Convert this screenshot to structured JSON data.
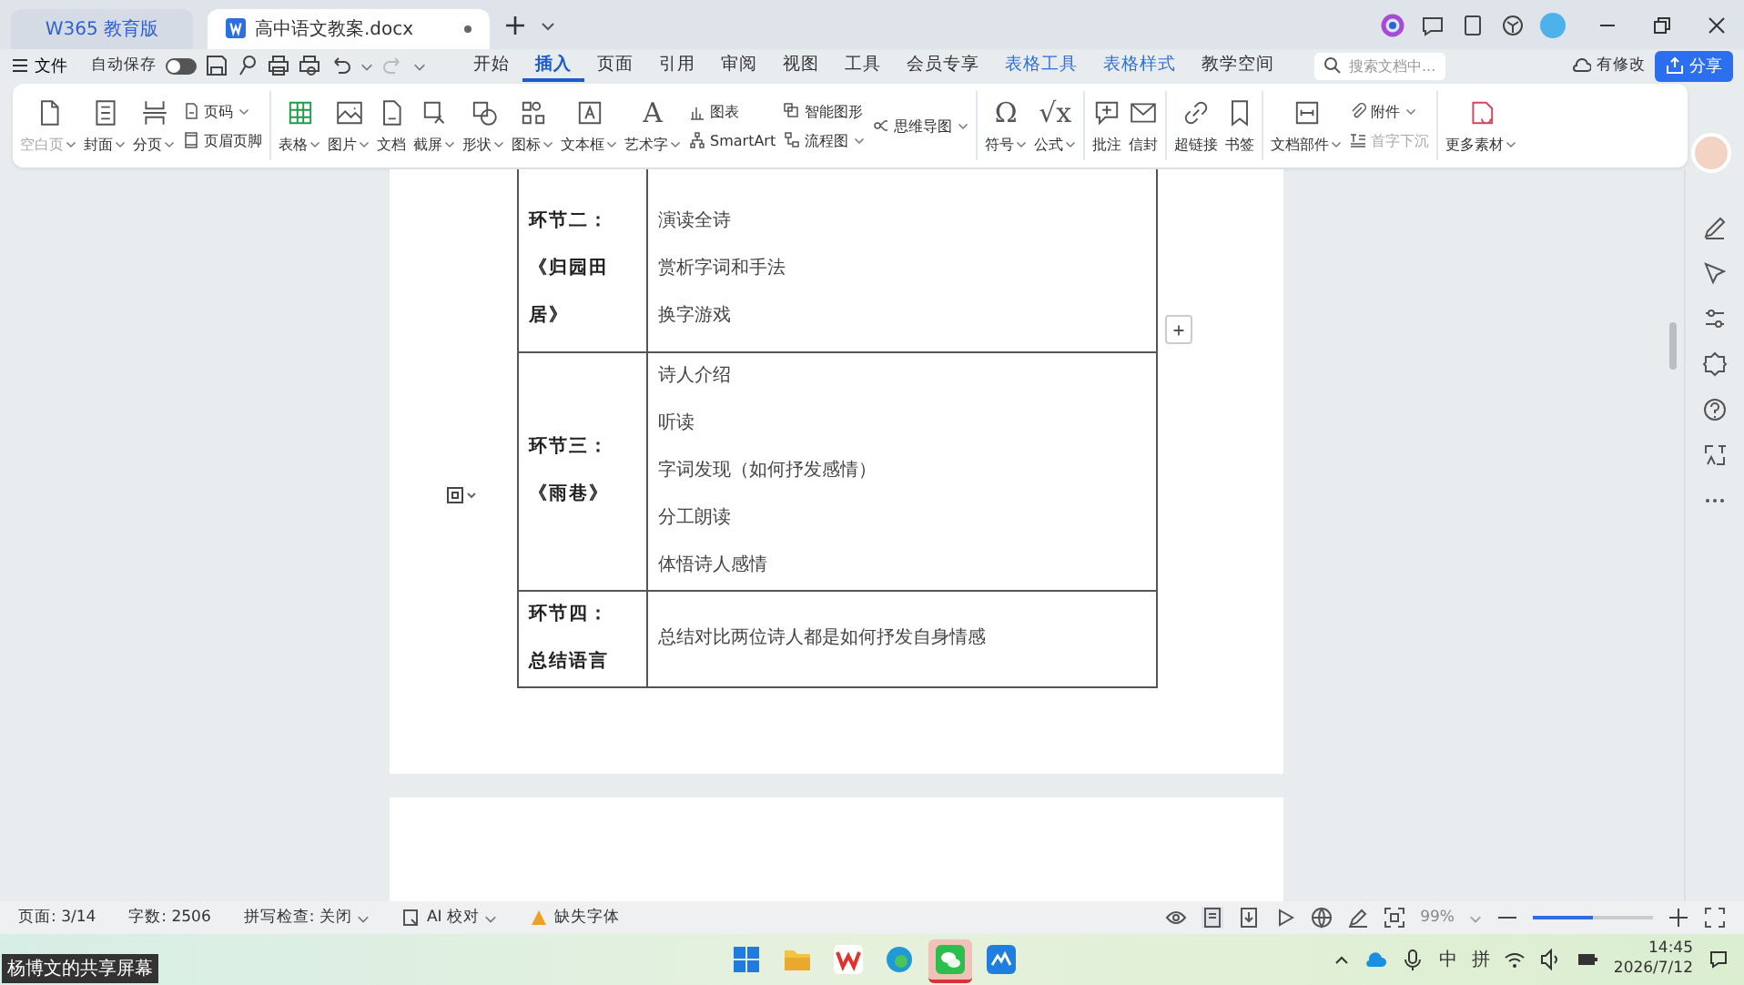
{
  "title_bar": {
    "tabs": [
      {
        "kind": "home",
        "label": "W365 教育版",
        "selected": false
      },
      {
        "kind": "doc",
        "label": "高中语文教案.docx",
        "selected": true
      }
    ]
  },
  "menu_bar": {
    "file": "文件",
    "autosave": {
      "label": "自动保存",
      "on": false
    },
    "tabs": [
      {
        "label": "开始",
        "selected": false,
        "contextual": false
      },
      {
        "label": "插入",
        "selected": true,
        "contextual": false
      },
      {
        "label": "页面",
        "selected": false,
        "contextual": false
      },
      {
        "label": "引用",
        "selected": false,
        "contextual": false
      },
      {
        "label": "审阅",
        "selected": false,
        "contextual": false
      },
      {
        "label": "视图",
        "selected": false,
        "contextual": false
      },
      {
        "label": "工具",
        "selected": false,
        "contextual": false
      },
      {
        "label": "会员专享",
        "selected": false,
        "contextual": false
      },
      {
        "label": "表格工具",
        "selected": false,
        "contextual": true
      },
      {
        "label": "表格样式",
        "selected": false,
        "contextual": true
      },
      {
        "label": "教学空间",
        "selected": false,
        "contextual": false
      }
    ],
    "search": {
      "placeholder": "搜索文档中..."
    },
    "status": "有修改",
    "share": "分享"
  },
  "ribbon": {
    "groups": [
      {
        "columns": [
          {
            "kind": "large",
            "label": "空白页",
            "dropdown": true,
            "disabled": true
          },
          {
            "kind": "large",
            "label": "封面",
            "dropdown": true,
            "disabled": false
          },
          {
            "kind": "large",
            "label": "分页",
            "dropdown": true,
            "disabled": false
          },
          {
            "kind": "stack",
            "items": [
              {
                "label": "页码",
                "dropdown": true,
                "disabled": false
              },
              {
                "label": "页眉页脚",
                "dropdown": false,
                "disabled": false
              }
            ]
          }
        ]
      },
      {
        "columns": [
          {
            "kind": "large",
            "label": "表格",
            "dropdown": true,
            "disabled": false
          },
          {
            "kind": "large",
            "label": "图片",
            "dropdown": true,
            "disabled": false
          },
          {
            "kind": "large",
            "label": "文档",
            "dropdown": false,
            "disabled": false
          },
          {
            "kind": "large",
            "label": "截屏",
            "dropdown": true,
            "disabled": false
          },
          {
            "kind": "large",
            "label": "形状",
            "dropdown": true,
            "disabled": false
          },
          {
            "kind": "large",
            "label": "图标",
            "dropdown": true,
            "disabled": false
          },
          {
            "kind": "large",
            "label": "文本框",
            "dropdown": true,
            "disabled": false
          },
          {
            "kind": "large",
            "label": "艺术字",
            "dropdown": true,
            "disabled": false,
            "glyph": "A"
          },
          {
            "kind": "stack",
            "items": [
              {
                "label": "图表",
                "dropdown": false,
                "disabled": false
              },
              {
                "label": "SmartArt",
                "dropdown": false,
                "disabled": false
              }
            ]
          },
          {
            "kind": "stack",
            "items": [
              {
                "label": "智能图形",
                "dropdown": false,
                "disabled": false
              },
              {
                "label": "流程图",
                "dropdown": true,
                "disabled": false
              }
            ]
          },
          {
            "kind": "stack",
            "items": [
              {
                "label": "思维导图",
                "dropdown": true,
                "disabled": false
              }
            ]
          }
        ]
      },
      {
        "columns": [
          {
            "kind": "large",
            "label": "符号",
            "dropdown": true,
            "disabled": false,
            "glyph": "Ω"
          },
          {
            "kind": "large",
            "label": "公式",
            "dropdown": true,
            "disabled": false,
            "glyph": "√x"
          }
        ]
      },
      {
        "columns": [
          {
            "kind": "large",
            "label": "批注",
            "dropdown": false,
            "disabled": false
          },
          {
            "kind": "large",
            "label": "信封",
            "dropdown": false,
            "disabled": false
          }
        ]
      },
      {
        "columns": [
          {
            "kind": "large",
            "label": "超链接",
            "dropdown": false,
            "disabled": false
          },
          {
            "kind": "large",
            "label": "书签",
            "dropdown": false,
            "disabled": false
          }
        ]
      },
      {
        "columns": [
          {
            "kind": "large",
            "label": "文档部件",
            "dropdown": true,
            "disabled": false
          },
          {
            "kind": "stack",
            "items": [
              {
                "label": "附件",
                "dropdown": true,
                "disabled": false
              },
              {
                "label": "首字下沉",
                "dropdown": false,
                "disabled": true
              }
            ]
          }
        ]
      },
      {
        "columns": [
          {
            "kind": "large",
            "label": "更多素材",
            "dropdown": true,
            "disabled": false
          }
        ]
      }
    ]
  },
  "document": {
    "table": {
      "rows": [
        {
          "heading": [
            "环节二：",
            "《归园田居》"
          ],
          "items": [
            "演读全诗",
            "赏析字词和手法",
            "换字游戏"
          ]
        },
        {
          "heading": [
            "环节三：",
            "《雨巷》"
          ],
          "items": [
            "诗人介绍",
            "听读",
            "字词发现（如何抒发感情）",
            "分工朗读",
            "体悟诗人感情"
          ]
        },
        {
          "heading": [
            "环节四：",
            "总结语言"
          ],
          "items": [
            "总结对比两位诗人都是如何抒发自身情感"
          ]
        }
      ]
    }
  },
  "status_bar": {
    "page": "页面: 3/14",
    "words": "字数: 2506",
    "spell": "拼写检查: 关闭",
    "ai": "AI 校对",
    "missing_font": "缺失字体",
    "zoom": "99%",
    "zoom_slider": {
      "level": 0.5
    }
  },
  "taskbar": {
    "apps": [
      {
        "kind": "windows",
        "selected": false
      },
      {
        "kind": "folder",
        "selected": false
      },
      {
        "kind": "wps",
        "selected": false
      },
      {
        "kind": "edge",
        "selected": false
      },
      {
        "kind": "wechat",
        "selected": true
      },
      {
        "kind": "app",
        "selected": false
      }
    ],
    "ime": [
      "中",
      "拼"
    ],
    "time": "14:45",
    "date": "2026/7/12"
  },
  "share_caption": "杨博文的共享屏幕"
}
